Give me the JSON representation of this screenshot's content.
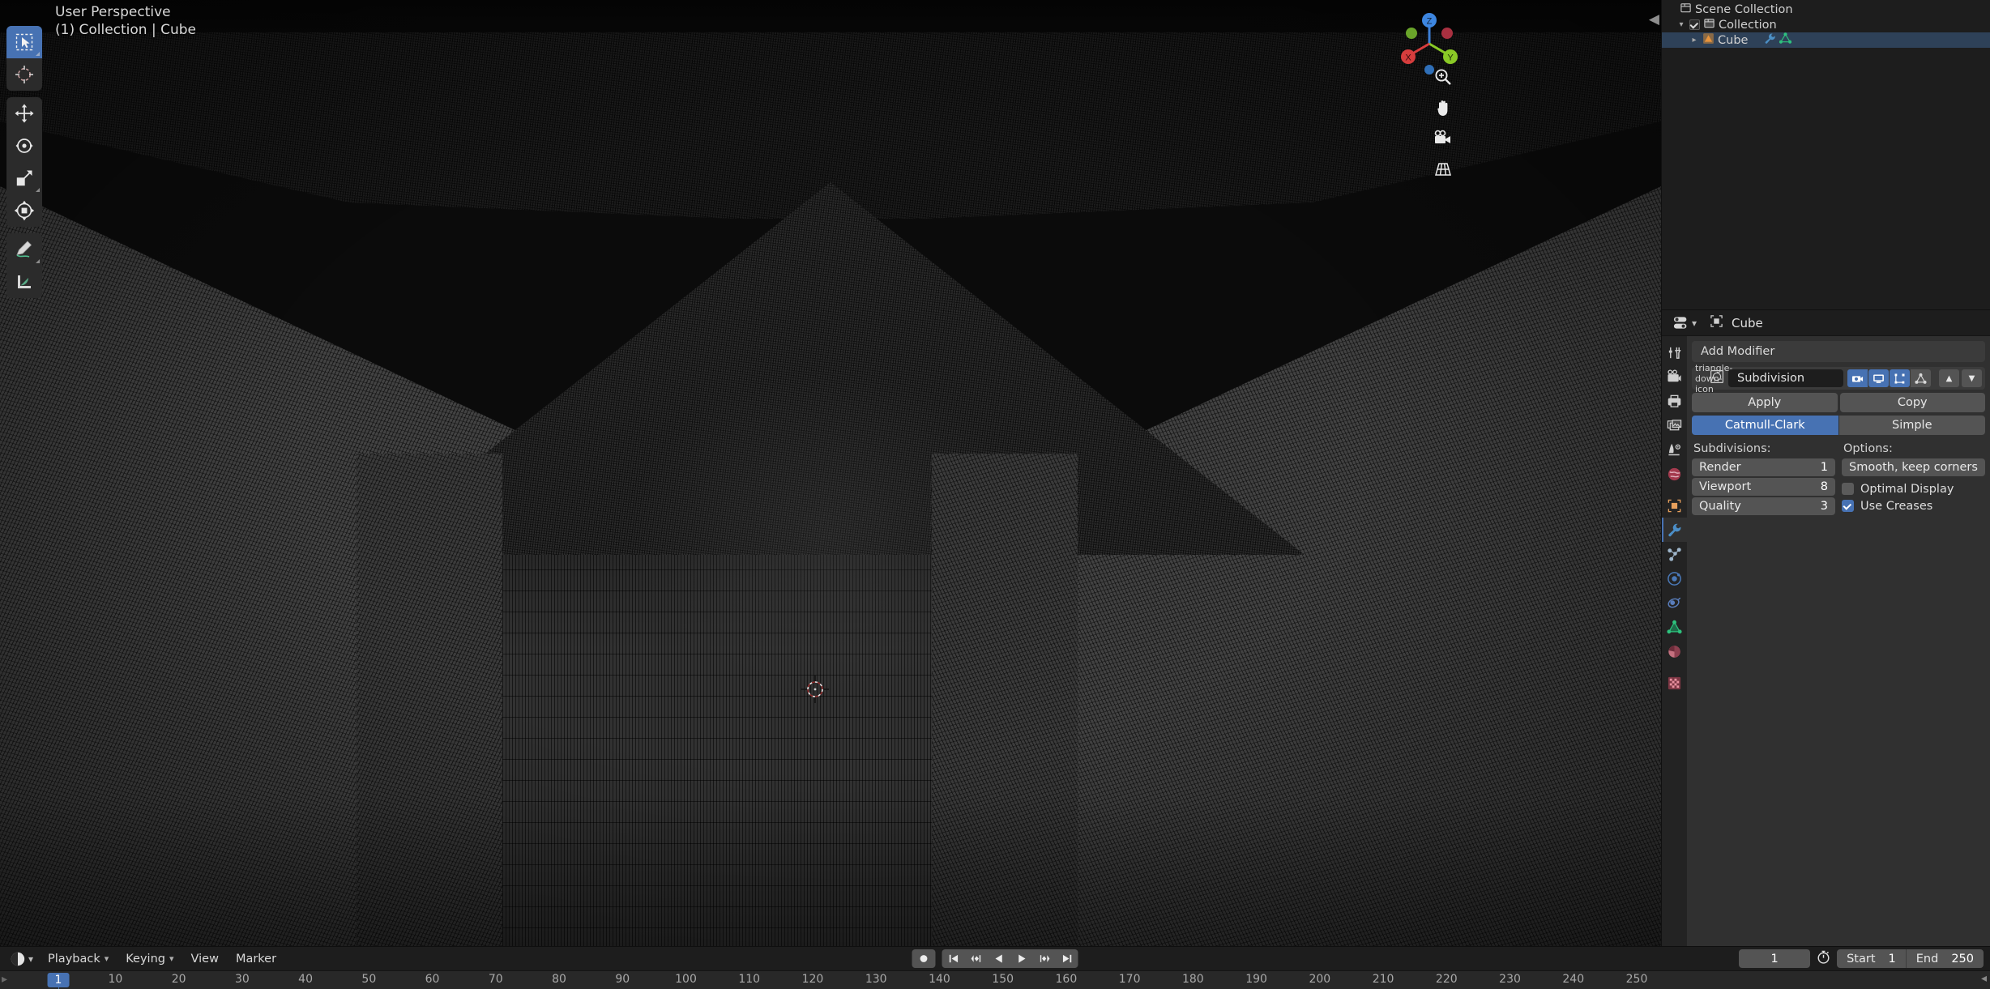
{
  "viewport": {
    "perspective_label": "User Perspective",
    "context_label": "(1) Collection | Cube",
    "gizmo": {
      "x": "X",
      "y": "Y",
      "z": "Z"
    },
    "toolbar": [
      {
        "name": "tweak-select-box-tool",
        "label": "Select Box",
        "active": true
      },
      {
        "name": "cursor-tool",
        "label": "Cursor",
        "active": false
      },
      {
        "name": "move-tool",
        "label": "Move",
        "active": false
      },
      {
        "name": "rotate-tool",
        "label": "Rotate",
        "active": false
      },
      {
        "name": "scale-tool",
        "label": "Scale",
        "active": false
      },
      {
        "name": "transform-tool",
        "label": "Transform",
        "active": false
      },
      {
        "name": "annotate-tool",
        "label": "Annotate",
        "active": false
      },
      {
        "name": "measure-tool",
        "label": "Measure",
        "active": false
      }
    ],
    "nav_buttons": [
      {
        "name": "zoom-icon",
        "label": "Zoom"
      },
      {
        "name": "pan-hand-icon",
        "label": "Move View"
      },
      {
        "name": "camera-icon",
        "label": "Camera View"
      },
      {
        "name": "grid-perspective-icon",
        "label": "Toggle Perspective/Orthographic"
      }
    ]
  },
  "outliner": {
    "rows": [
      {
        "label": "Scene Collection",
        "icon": "collection-icon",
        "depth": 0,
        "disclosure": "",
        "checkbox": null,
        "selected": false
      },
      {
        "label": "Collection",
        "icon": "collection-icon",
        "depth": 1,
        "disclosure": "▾",
        "checkbox": true,
        "selected": false
      },
      {
        "label": "Cube",
        "icon": "mesh-object-icon",
        "depth": 2,
        "disclosure": "▸",
        "checkbox": null,
        "selected": true,
        "extra_icons": [
          "wrench-modifier-icon",
          "mesh-data-icon"
        ]
      }
    ]
  },
  "properties": {
    "header": {
      "editor_type_icon": "properties-editor-icon",
      "breadcrumb_icon": "object-icon",
      "breadcrumb": "Cube"
    },
    "tabs": [
      {
        "name": "tab-tool",
        "icon": "tool-icon",
        "active": false
      },
      {
        "name": "tab-render",
        "icon": "render-camera-icon",
        "active": false
      },
      {
        "name": "tab-output",
        "icon": "output-printer-icon",
        "active": false
      },
      {
        "name": "tab-view-layer",
        "icon": "view-layer-images-icon",
        "active": false
      },
      {
        "name": "tab-scene",
        "icon": "scene-cone-icon",
        "active": false
      },
      {
        "name": "tab-world",
        "icon": "world-globe-icon",
        "active": false
      },
      {
        "name": "tab-object",
        "icon": "object-square-icon",
        "active": false
      },
      {
        "name": "tab-modifiers",
        "icon": "wrench-icon",
        "active": true
      },
      {
        "name": "tab-particles",
        "icon": "particles-icon",
        "active": false
      },
      {
        "name": "tab-physics",
        "icon": "physics-orbit-icon",
        "active": false
      },
      {
        "name": "tab-constraints",
        "icon": "constraints-icon",
        "active": false
      },
      {
        "name": "tab-object-data",
        "icon": "mesh-data-triangle-icon",
        "active": false
      },
      {
        "name": "tab-material",
        "icon": "material-sphere-icon",
        "active": false
      },
      {
        "name": "tab-texture",
        "icon": "texture-checker-icon",
        "active": false
      }
    ],
    "add_modifier_label": "Add Modifier",
    "modifier": {
      "expand_icon": "triangle-down-icon",
      "type_icon": "subdivision-surface-icon",
      "name": "Subdivision",
      "display_toggles": [
        {
          "name": "render-toggle",
          "icon": "camera-icon",
          "on": true
        },
        {
          "name": "realtime-viewport-toggle",
          "icon": "display-monitor-icon",
          "on": true
        },
        {
          "name": "edit-mode-toggle",
          "icon": "edit-mode-icon",
          "on": true
        },
        {
          "name": "on-cage-toggle",
          "icon": "on-cage-vertex-icon",
          "on": false
        }
      ],
      "move_up_label": "▲",
      "move_down_label": "▼",
      "apply_label": "Apply",
      "copy_label": "Copy",
      "algorithms": [
        {
          "label": "Catmull-Clark",
          "on": true
        },
        {
          "label": "Simple",
          "on": false
        }
      ],
      "subdivisions_label": "Subdivisions:",
      "subdivisions": [
        {
          "label": "Render",
          "value": "1"
        },
        {
          "label": "Viewport",
          "value": "8"
        },
        {
          "label": "Quality",
          "value": "3"
        }
      ],
      "options_label": "Options:",
      "uv_smooth": "Smooth, keep corners",
      "options": [
        {
          "label": "Optimal Display",
          "checked": false
        },
        {
          "label": "Use Creases",
          "checked": true
        }
      ]
    }
  },
  "timeline": {
    "editor_type_icon": "timeline-editor-icon",
    "menus": [
      {
        "label": "Playback",
        "has_arrow": true
      },
      {
        "label": "Keying",
        "has_arrow": true
      },
      {
        "label": "View",
        "has_arrow": false
      },
      {
        "label": "Marker",
        "has_arrow": false
      }
    ],
    "playback_buttons": [
      {
        "name": "record-auto-keying-button",
        "icon": "record-dot-icon"
      },
      {
        "name": "jump-to-start-button",
        "icon": "jump-start-icon"
      },
      {
        "name": "previous-keyframe-button",
        "icon": "prev-keyframe-icon"
      },
      {
        "name": "play-reverse-button",
        "icon": "play-reverse-icon"
      },
      {
        "name": "play-button",
        "icon": "play-icon"
      },
      {
        "name": "next-keyframe-button",
        "icon": "next-keyframe-icon"
      },
      {
        "name": "jump-to-end-button",
        "icon": "jump-end-icon"
      }
    ],
    "current_frame": "1",
    "use_preview_range_icon": "stopwatch-icon",
    "start_label": "Start",
    "start_value": "1",
    "end_label": "End",
    "end_value": "250",
    "playhead_frame": 1,
    "ruler_ticks": [
      10,
      20,
      30,
      40,
      50,
      60,
      70,
      80,
      90,
      100,
      110,
      120,
      130,
      140,
      150,
      160,
      170,
      180,
      190,
      200,
      210,
      220,
      230,
      240,
      250
    ]
  },
  "colors": {
    "accent_blue": "#4772b3",
    "panel_bg": "#303030",
    "editor_bg": "#1d1d1d",
    "button_gray": "#545454",
    "object_orange": "#e8a05c",
    "mesh_green": "#2ec27e"
  }
}
